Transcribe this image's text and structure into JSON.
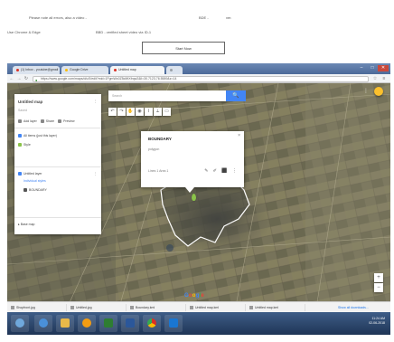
{
  "document": {
    "line1_left": "Please note all errors, also a video -",
    "line1_mid": "BDE -",
    "line1_right": "ver.",
    "line2_left": "Use Chrome & Edge",
    "line2_mid": "BBD - verified sheet video via ID-1",
    "button_label": "Start Now"
  },
  "browser": {
    "tabs": [
      {
        "label": "(1) Inbox - youtube@gmail",
        "color": "#d93025",
        "active": false
      },
      {
        "label": "Google Drive",
        "color": "#fbbc04",
        "active": false
      },
      {
        "label": "Untitled map",
        "color": "#d93025",
        "active": true
      },
      {
        "label": "",
        "color": "#9aa0a6",
        "active": false
      }
    ],
    "url": "https://www.google.com/maps/d/u/0/edit?mid=1FgmWo0Z5cMtXfrqw2&ll=30.7123,76.5589&z=14",
    "controls": {
      "back": "←",
      "forward": "→",
      "reload": "↻",
      "star": "☆",
      "menu": "≡",
      "minimize": "–",
      "maximize": "□",
      "close": "✕"
    }
  },
  "map_panel": {
    "title": "Untitled map",
    "subtitle": "Saved",
    "actions": [
      "Add layer",
      "Share",
      "Preview"
    ],
    "all_items": "All items (just this layer)",
    "style_label": "Style",
    "layer_name": "Untitled layer",
    "layer_sub": "Individual styles",
    "layer_item": "BOUNDARY",
    "base_map": "Base map"
  },
  "map": {
    "search_placeholder": "Search",
    "search_button": "🔍",
    "tools": [
      "↶",
      "↷",
      "✋",
      "◉",
      "⌇",
      "⟂",
      "▭"
    ],
    "popup": {
      "title": "BOUNDARY",
      "subtitle": "polygon",
      "footer": "Lines 1  Area 1",
      "actions": "✎ ✐ ⬛ ⋮",
      "close": "×"
    },
    "zoom_in": "+",
    "zoom_out": "−",
    "google_logo": [
      {
        "ch": "G",
        "color": "#4285f4"
      },
      {
        "ch": "o",
        "color": "#ea4335"
      },
      {
        "ch": "o",
        "color": "#fbbc05"
      },
      {
        "ch": "g",
        "color": "#4285f4"
      },
      {
        "ch": "l",
        "color": "#34a853"
      },
      {
        "ch": "e",
        "color": "#ea4335"
      }
    ],
    "footer": "Map data ©2018 Google  Imagery ©2018 DigitalGlobe  Terms  Send feedback  200 m"
  },
  "downloads": {
    "items": [
      "Shopfront.jpg",
      "Untitled.jpg",
      "Boundary.kml",
      "Untitled map.kml",
      "Untitled map.kml"
    ],
    "show_all": "Show all downloads..."
  },
  "taskbar": {
    "apps": [
      {
        "name": "start",
        "color": "#6fa8dc"
      },
      {
        "name": "ie",
        "color": "#4a90d9"
      },
      {
        "name": "explorer",
        "color": "#e8b84a"
      },
      {
        "name": "media",
        "color": "#f39c12"
      },
      {
        "name": "excel",
        "color": "#2e7d32"
      },
      {
        "name": "word",
        "color": "#2b579a"
      },
      {
        "name": "chrome",
        "color": "#d93025"
      },
      {
        "name": "photoshop",
        "color": "#1976d2"
      }
    ],
    "time": "11:24 AM",
    "date": "02-06-2018"
  }
}
